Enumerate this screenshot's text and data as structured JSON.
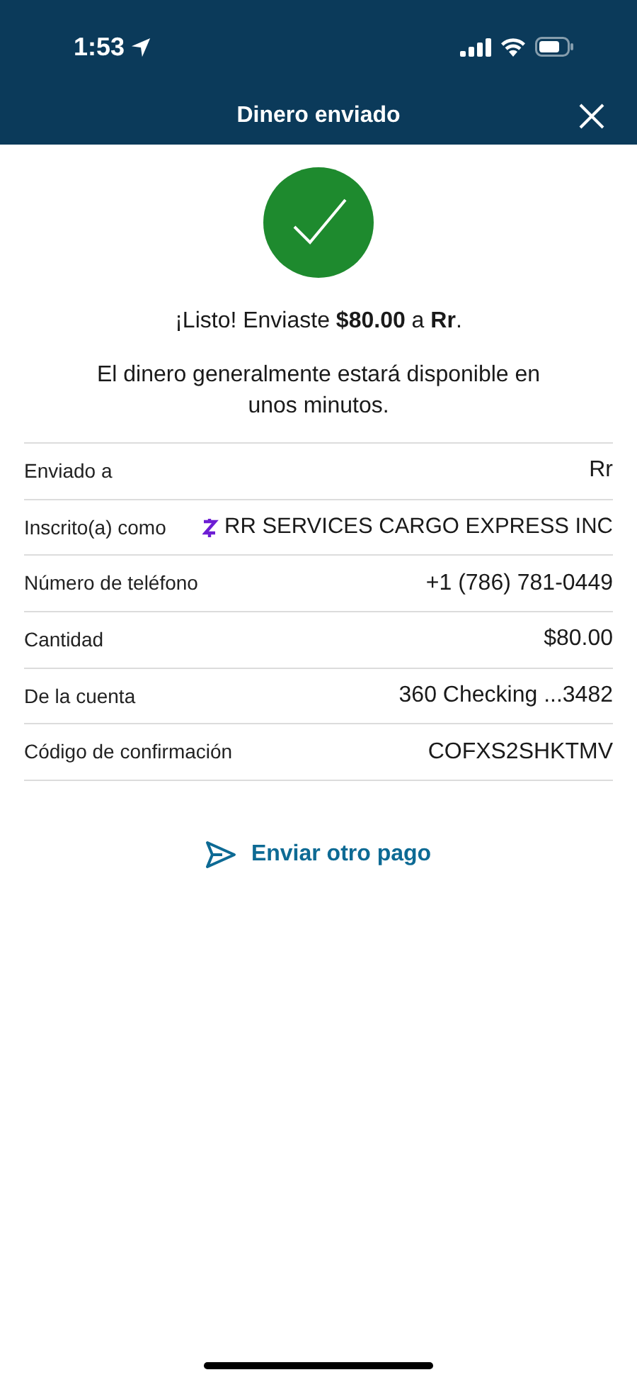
{
  "status_bar": {
    "time": "1:53"
  },
  "header": {
    "title": "Dinero enviado"
  },
  "confirmation": {
    "message": "¡Listo! Enviaste **$80.00** a **Rr**.",
    "note": "El dinero generalmente estará disponible en unos minutos."
  },
  "details": [
    {
      "label": "Enviado a",
      "value": "Rr",
      "kind": "plain"
    },
    {
      "label": "Inscrito(a) como",
      "value": "RR SERVICES CARGO EXPRESS INC",
      "kind": "zelle"
    },
    {
      "label": "Número de teléfono",
      "value": "+1 (786) 781-0449",
      "kind": "plain"
    },
    {
      "label": "Cantidad",
      "value": "$80.00",
      "kind": "plain"
    },
    {
      "label": "De la cuenta",
      "value": "360 Checking ...3482",
      "kind": "plain"
    },
    {
      "label": "Código de confirmación",
      "value": "COFXS2SHKTMV",
      "kind": "plain"
    }
  ],
  "action": {
    "label": "Enviar otro pago"
  }
}
